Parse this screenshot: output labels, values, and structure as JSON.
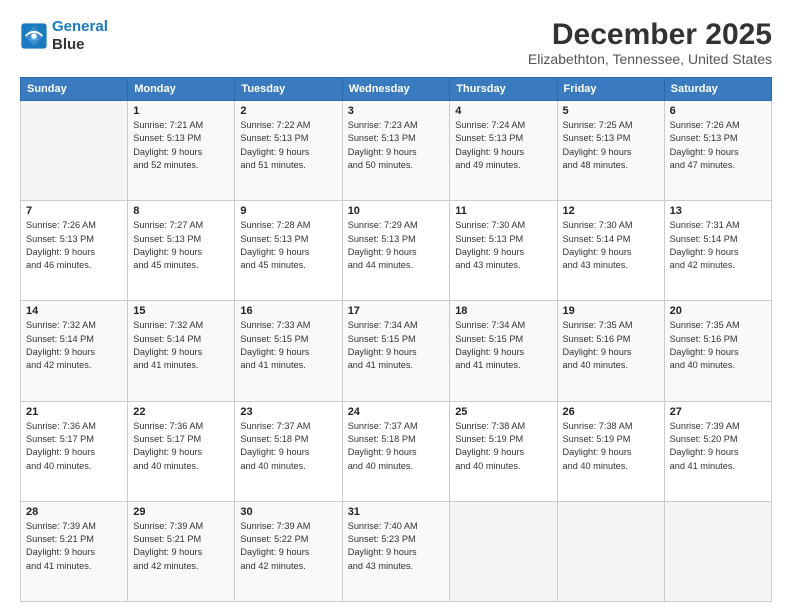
{
  "logo": {
    "line1": "General",
    "line2": "Blue"
  },
  "title": "December 2025",
  "subtitle": "Elizabethton, Tennessee, United States",
  "days_header": [
    "Sunday",
    "Monday",
    "Tuesday",
    "Wednesday",
    "Thursday",
    "Friday",
    "Saturday"
  ],
  "weeks": [
    [
      {
        "day": "",
        "info": ""
      },
      {
        "day": "1",
        "info": "Sunrise: 7:21 AM\nSunset: 5:13 PM\nDaylight: 9 hours\nand 52 minutes."
      },
      {
        "day": "2",
        "info": "Sunrise: 7:22 AM\nSunset: 5:13 PM\nDaylight: 9 hours\nand 51 minutes."
      },
      {
        "day": "3",
        "info": "Sunrise: 7:23 AM\nSunset: 5:13 PM\nDaylight: 9 hours\nand 50 minutes."
      },
      {
        "day": "4",
        "info": "Sunrise: 7:24 AM\nSunset: 5:13 PM\nDaylight: 9 hours\nand 49 minutes."
      },
      {
        "day": "5",
        "info": "Sunrise: 7:25 AM\nSunset: 5:13 PM\nDaylight: 9 hours\nand 48 minutes."
      },
      {
        "day": "6",
        "info": "Sunrise: 7:26 AM\nSunset: 5:13 PM\nDaylight: 9 hours\nand 47 minutes."
      }
    ],
    [
      {
        "day": "7",
        "info": "Sunrise: 7:26 AM\nSunset: 5:13 PM\nDaylight: 9 hours\nand 46 minutes."
      },
      {
        "day": "8",
        "info": "Sunrise: 7:27 AM\nSunset: 5:13 PM\nDaylight: 9 hours\nand 45 minutes."
      },
      {
        "day": "9",
        "info": "Sunrise: 7:28 AM\nSunset: 5:13 PM\nDaylight: 9 hours\nand 45 minutes."
      },
      {
        "day": "10",
        "info": "Sunrise: 7:29 AM\nSunset: 5:13 PM\nDaylight: 9 hours\nand 44 minutes."
      },
      {
        "day": "11",
        "info": "Sunrise: 7:30 AM\nSunset: 5:13 PM\nDaylight: 9 hours\nand 43 minutes."
      },
      {
        "day": "12",
        "info": "Sunrise: 7:30 AM\nSunset: 5:14 PM\nDaylight: 9 hours\nand 43 minutes."
      },
      {
        "day": "13",
        "info": "Sunrise: 7:31 AM\nSunset: 5:14 PM\nDaylight: 9 hours\nand 42 minutes."
      }
    ],
    [
      {
        "day": "14",
        "info": "Sunrise: 7:32 AM\nSunset: 5:14 PM\nDaylight: 9 hours\nand 42 minutes."
      },
      {
        "day": "15",
        "info": "Sunrise: 7:32 AM\nSunset: 5:14 PM\nDaylight: 9 hours\nand 41 minutes."
      },
      {
        "day": "16",
        "info": "Sunrise: 7:33 AM\nSunset: 5:15 PM\nDaylight: 9 hours\nand 41 minutes."
      },
      {
        "day": "17",
        "info": "Sunrise: 7:34 AM\nSunset: 5:15 PM\nDaylight: 9 hours\nand 41 minutes."
      },
      {
        "day": "18",
        "info": "Sunrise: 7:34 AM\nSunset: 5:15 PM\nDaylight: 9 hours\nand 41 minutes."
      },
      {
        "day": "19",
        "info": "Sunrise: 7:35 AM\nSunset: 5:16 PM\nDaylight: 9 hours\nand 40 minutes."
      },
      {
        "day": "20",
        "info": "Sunrise: 7:35 AM\nSunset: 5:16 PM\nDaylight: 9 hours\nand 40 minutes."
      }
    ],
    [
      {
        "day": "21",
        "info": "Sunrise: 7:36 AM\nSunset: 5:17 PM\nDaylight: 9 hours\nand 40 minutes."
      },
      {
        "day": "22",
        "info": "Sunrise: 7:36 AM\nSunset: 5:17 PM\nDaylight: 9 hours\nand 40 minutes."
      },
      {
        "day": "23",
        "info": "Sunrise: 7:37 AM\nSunset: 5:18 PM\nDaylight: 9 hours\nand 40 minutes."
      },
      {
        "day": "24",
        "info": "Sunrise: 7:37 AM\nSunset: 5:18 PM\nDaylight: 9 hours\nand 40 minutes."
      },
      {
        "day": "25",
        "info": "Sunrise: 7:38 AM\nSunset: 5:19 PM\nDaylight: 9 hours\nand 40 minutes."
      },
      {
        "day": "26",
        "info": "Sunrise: 7:38 AM\nSunset: 5:19 PM\nDaylight: 9 hours\nand 40 minutes."
      },
      {
        "day": "27",
        "info": "Sunrise: 7:39 AM\nSunset: 5:20 PM\nDaylight: 9 hours\nand 41 minutes."
      }
    ],
    [
      {
        "day": "28",
        "info": "Sunrise: 7:39 AM\nSunset: 5:21 PM\nDaylight: 9 hours\nand 41 minutes."
      },
      {
        "day": "29",
        "info": "Sunrise: 7:39 AM\nSunset: 5:21 PM\nDaylight: 9 hours\nand 42 minutes."
      },
      {
        "day": "30",
        "info": "Sunrise: 7:39 AM\nSunset: 5:22 PM\nDaylight: 9 hours\nand 42 minutes."
      },
      {
        "day": "31",
        "info": "Sunrise: 7:40 AM\nSunset: 5:23 PM\nDaylight: 9 hours\nand 43 minutes."
      },
      {
        "day": "",
        "info": ""
      },
      {
        "day": "",
        "info": ""
      },
      {
        "day": "",
        "info": ""
      }
    ]
  ]
}
